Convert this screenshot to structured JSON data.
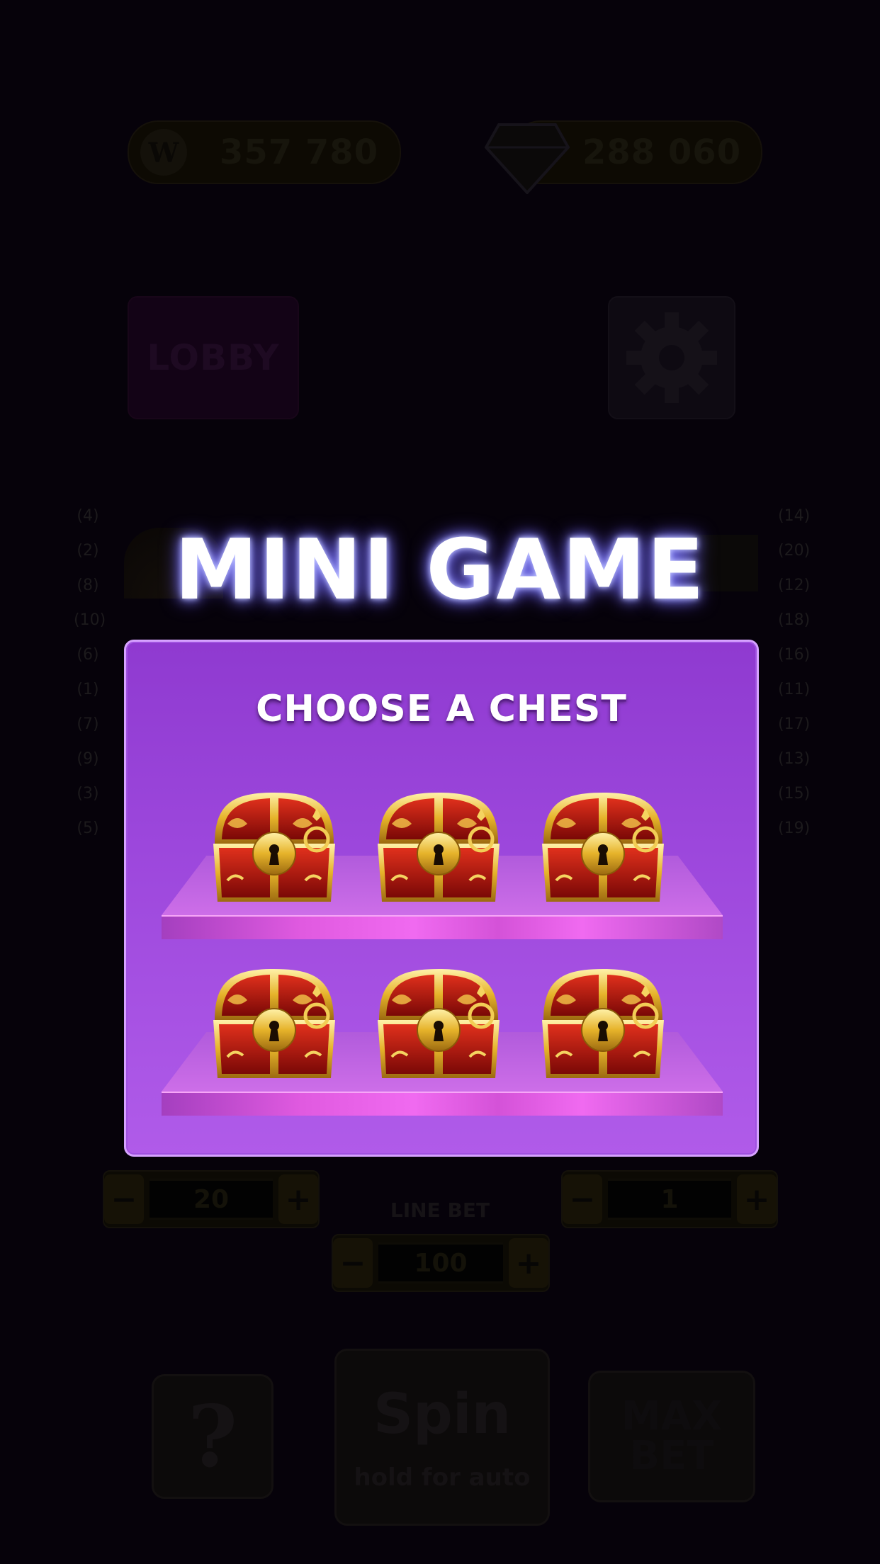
{
  "header": {
    "coins_icon": "W",
    "coins_value": "357 780",
    "gems_value": "288 060"
  },
  "nav": {
    "lobby_label": "LOBBY",
    "settings_icon": "gear-icon"
  },
  "paylines": {
    "left": [
      "4",
      "2",
      "8",
      "10",
      "6",
      "1",
      "7",
      "9",
      "3",
      "5"
    ],
    "right": [
      "14",
      "20",
      "12",
      "18",
      "16",
      "11",
      "17",
      "13",
      "15",
      "19"
    ]
  },
  "controls": {
    "lines_value": "20",
    "bet_value": "1",
    "line_bet_label": "LINE BET",
    "line_bet_value": "100",
    "minus_symbol": "−",
    "plus_symbol": "+"
  },
  "actions": {
    "help_label": "?",
    "spin_label": "Spin",
    "spin_sub": "hold for auto",
    "max_bet_line1": "MAX",
    "max_bet_line2": "BET"
  },
  "mini_game": {
    "title": "MINI GAME",
    "subtitle": "CHOOSE A CHEST",
    "chest_count": 6
  },
  "colors": {
    "panel": "#9c47dc",
    "panel_border": "#d6a2ff",
    "title_glow": "#8b8fff",
    "chest_red": "#c0140c",
    "chest_gold": "#e6b32a"
  }
}
